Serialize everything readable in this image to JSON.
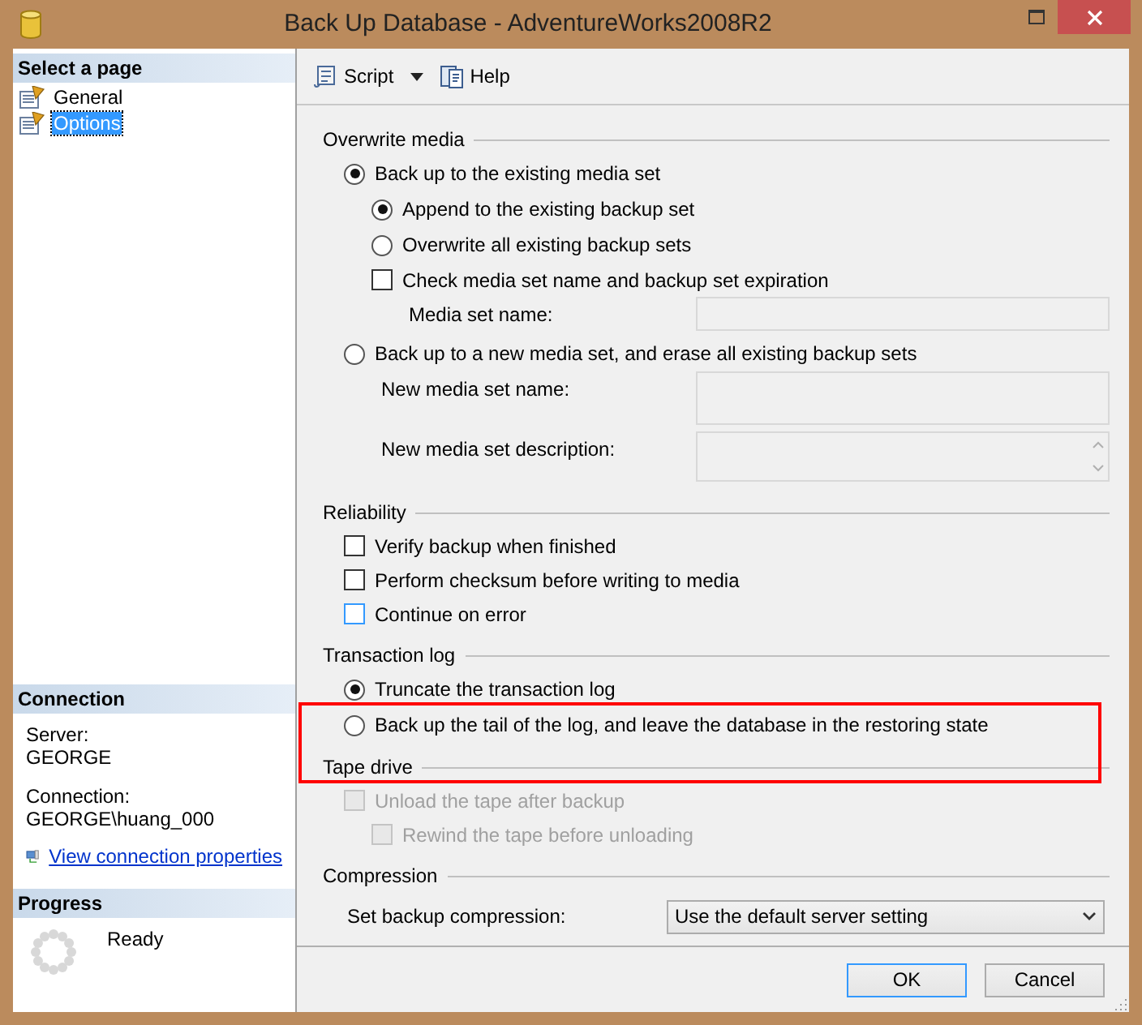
{
  "window": {
    "title": "Back Up Database - AdventureWorks2008R2"
  },
  "sidebar": {
    "title": "Select a page",
    "items": [
      {
        "label": "General",
        "selected": false
      },
      {
        "label": "Options",
        "selected": true
      }
    ]
  },
  "connection": {
    "title": "Connection",
    "server_label": "Server:",
    "server": "GEORGE",
    "connection_label": "Connection:",
    "connection": "GEORGE\\huang_000",
    "link": "View connection properties"
  },
  "progress": {
    "title": "Progress",
    "status": "Ready"
  },
  "toolbar": {
    "script": "Script",
    "help": "Help"
  },
  "sections": [
    {
      "title": "Overwrite media",
      "rows": [
        {
          "kind": "radio",
          "label": "Back up to the existing media set",
          "selected": true,
          "disabled": false,
          "children": [
            {
              "kind": "radio",
              "label": "Append to the existing backup set",
              "selected": true,
              "disabled": false
            },
            {
              "kind": "radio",
              "label": "Overwrite all existing backup sets",
              "selected": false,
              "disabled": false
            },
            {
              "kind": "checkbox",
              "label": "Check media set name and backup set expiration",
              "checked": false,
              "focused": false,
              "disabled": false,
              "children": [
                {
                  "kind": "field",
                  "label": "Media set name:",
                  "disabled": true
                }
              ]
            }
          ]
        },
        {
          "kind": "radio",
          "label": "Back up to a new media set, and erase all existing backup sets",
          "selected": false,
          "disabled": false,
          "children": [
            {
              "kind": "tallfield",
              "label": "New media set name:",
              "disabled": true
            },
            {
              "kind": "textarea",
              "label": "New media set description:",
              "disabled": true
            }
          ]
        }
      ]
    },
    {
      "title": "Reliability",
      "rows": [
        {
          "kind": "checkbox",
          "label": "Verify backup when finished",
          "checked": false,
          "focused": false,
          "disabled": false
        },
        {
          "kind": "checkbox",
          "label": "Perform checksum before writing to media",
          "checked": false,
          "focused": false,
          "disabled": false
        },
        {
          "kind": "checkbox",
          "label": "Continue on error",
          "checked": false,
          "focused": true,
          "disabled": false
        }
      ]
    },
    {
      "title": "Transaction log",
      "rows": [
        {
          "kind": "radio",
          "label": "Truncate the transaction log",
          "selected": true,
          "disabled": false
        },
        {
          "kind": "radio",
          "label": "Back up the tail of the log, and leave the database in the restoring state",
          "selected": false,
          "disabled": false
        }
      ]
    },
    {
      "title": "Tape drive",
      "rows": [
        {
          "kind": "checkbox",
          "label": "Unload the tape after backup",
          "checked": false,
          "disabled": true,
          "children": [
            {
              "kind": "checkbox",
              "label": "Rewind the tape before unloading",
              "checked": false,
              "disabled": true
            }
          ]
        }
      ]
    },
    {
      "title": "Compression",
      "rows": [
        {
          "kind": "select",
          "label": "Set backup compression:",
          "value": "Use the default server setting"
        }
      ]
    }
  ],
  "annotation": {
    "kind": "highlight-box"
  },
  "buttons": [
    {
      "label": "OK",
      "default": true
    },
    {
      "label": "Cancel",
      "default": false
    }
  ]
}
